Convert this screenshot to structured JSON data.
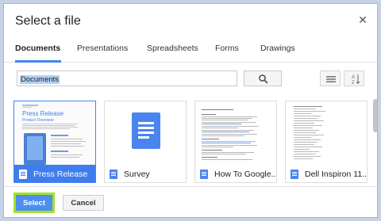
{
  "dialog": {
    "title": "Select a file",
    "close_glyph": "✕"
  },
  "tabs": [
    {
      "label": "Documents",
      "active": true
    },
    {
      "label": "Presentations",
      "active": false
    },
    {
      "label": "Spreadsheets",
      "active": false
    },
    {
      "label": "Forms",
      "active": false
    },
    {
      "label": "Drawings",
      "active": false
    }
  ],
  "search": {
    "value": "Documents",
    "search_icon": "magnifier-icon",
    "list_view_icon": "list-view-icon",
    "sort_icon": "sort-az-icon",
    "sort_label": "A Z"
  },
  "files": [
    {
      "name": "Press Release",
      "selected": true,
      "preview_title": "Press Release",
      "preview_subtitle": "Product Overview"
    },
    {
      "name": "Survey",
      "selected": false
    },
    {
      "name": "How To Google...",
      "selected": false
    },
    {
      "name": "Dell Inspiron 11...",
      "selected": false
    }
  ],
  "footer": {
    "select_label": "Select",
    "cancel_label": "Cancel"
  },
  "colors": {
    "accent": "#4285f4",
    "select_outline": "#a4e02b",
    "doc_blue": "#4a84ef"
  }
}
